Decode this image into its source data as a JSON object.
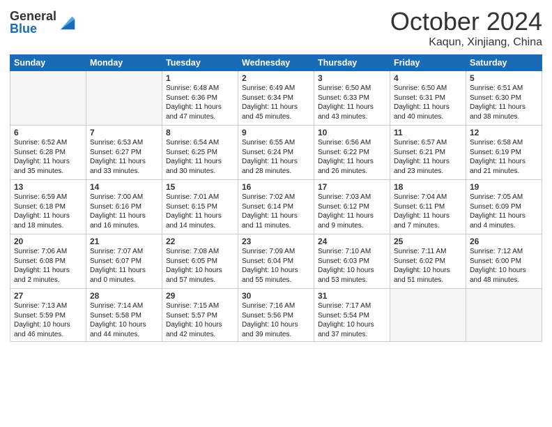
{
  "header": {
    "logo_general": "General",
    "logo_blue": "Blue",
    "month_title": "October 2024",
    "location": "Kaqun, Xinjiang, China"
  },
  "days_of_week": [
    "Sunday",
    "Monday",
    "Tuesday",
    "Wednesday",
    "Thursday",
    "Friday",
    "Saturday"
  ],
  "weeks": [
    [
      {
        "day": "",
        "info": ""
      },
      {
        "day": "",
        "info": ""
      },
      {
        "day": "1",
        "info": "Sunrise: 6:48 AM\nSunset: 6:36 PM\nDaylight: 11 hours and 47 minutes."
      },
      {
        "day": "2",
        "info": "Sunrise: 6:49 AM\nSunset: 6:34 PM\nDaylight: 11 hours and 45 minutes."
      },
      {
        "day": "3",
        "info": "Sunrise: 6:50 AM\nSunset: 6:33 PM\nDaylight: 11 hours and 43 minutes."
      },
      {
        "day": "4",
        "info": "Sunrise: 6:50 AM\nSunset: 6:31 PM\nDaylight: 11 hours and 40 minutes."
      },
      {
        "day": "5",
        "info": "Sunrise: 6:51 AM\nSunset: 6:30 PM\nDaylight: 11 hours and 38 minutes."
      }
    ],
    [
      {
        "day": "6",
        "info": "Sunrise: 6:52 AM\nSunset: 6:28 PM\nDaylight: 11 hours and 35 minutes."
      },
      {
        "day": "7",
        "info": "Sunrise: 6:53 AM\nSunset: 6:27 PM\nDaylight: 11 hours and 33 minutes."
      },
      {
        "day": "8",
        "info": "Sunrise: 6:54 AM\nSunset: 6:25 PM\nDaylight: 11 hours and 30 minutes."
      },
      {
        "day": "9",
        "info": "Sunrise: 6:55 AM\nSunset: 6:24 PM\nDaylight: 11 hours and 28 minutes."
      },
      {
        "day": "10",
        "info": "Sunrise: 6:56 AM\nSunset: 6:22 PM\nDaylight: 11 hours and 26 minutes."
      },
      {
        "day": "11",
        "info": "Sunrise: 6:57 AM\nSunset: 6:21 PM\nDaylight: 11 hours and 23 minutes."
      },
      {
        "day": "12",
        "info": "Sunrise: 6:58 AM\nSunset: 6:19 PM\nDaylight: 11 hours and 21 minutes."
      }
    ],
    [
      {
        "day": "13",
        "info": "Sunrise: 6:59 AM\nSunset: 6:18 PM\nDaylight: 11 hours and 18 minutes."
      },
      {
        "day": "14",
        "info": "Sunrise: 7:00 AM\nSunset: 6:16 PM\nDaylight: 11 hours and 16 minutes."
      },
      {
        "day": "15",
        "info": "Sunrise: 7:01 AM\nSunset: 6:15 PM\nDaylight: 11 hours and 14 minutes."
      },
      {
        "day": "16",
        "info": "Sunrise: 7:02 AM\nSunset: 6:14 PM\nDaylight: 11 hours and 11 minutes."
      },
      {
        "day": "17",
        "info": "Sunrise: 7:03 AM\nSunset: 6:12 PM\nDaylight: 11 hours and 9 minutes."
      },
      {
        "day": "18",
        "info": "Sunrise: 7:04 AM\nSunset: 6:11 PM\nDaylight: 11 hours and 7 minutes."
      },
      {
        "day": "19",
        "info": "Sunrise: 7:05 AM\nSunset: 6:09 PM\nDaylight: 11 hours and 4 minutes."
      }
    ],
    [
      {
        "day": "20",
        "info": "Sunrise: 7:06 AM\nSunset: 6:08 PM\nDaylight: 11 hours and 2 minutes."
      },
      {
        "day": "21",
        "info": "Sunrise: 7:07 AM\nSunset: 6:07 PM\nDaylight: 11 hours and 0 minutes."
      },
      {
        "day": "22",
        "info": "Sunrise: 7:08 AM\nSunset: 6:05 PM\nDaylight: 10 hours and 57 minutes."
      },
      {
        "day": "23",
        "info": "Sunrise: 7:09 AM\nSunset: 6:04 PM\nDaylight: 10 hours and 55 minutes."
      },
      {
        "day": "24",
        "info": "Sunrise: 7:10 AM\nSunset: 6:03 PM\nDaylight: 10 hours and 53 minutes."
      },
      {
        "day": "25",
        "info": "Sunrise: 7:11 AM\nSunset: 6:02 PM\nDaylight: 10 hours and 51 minutes."
      },
      {
        "day": "26",
        "info": "Sunrise: 7:12 AM\nSunset: 6:00 PM\nDaylight: 10 hours and 48 minutes."
      }
    ],
    [
      {
        "day": "27",
        "info": "Sunrise: 7:13 AM\nSunset: 5:59 PM\nDaylight: 10 hours and 46 minutes."
      },
      {
        "day": "28",
        "info": "Sunrise: 7:14 AM\nSunset: 5:58 PM\nDaylight: 10 hours and 44 minutes."
      },
      {
        "day": "29",
        "info": "Sunrise: 7:15 AM\nSunset: 5:57 PM\nDaylight: 10 hours and 42 minutes."
      },
      {
        "day": "30",
        "info": "Sunrise: 7:16 AM\nSunset: 5:56 PM\nDaylight: 10 hours and 39 minutes."
      },
      {
        "day": "31",
        "info": "Sunrise: 7:17 AM\nSunset: 5:54 PM\nDaylight: 10 hours and 37 minutes."
      },
      {
        "day": "",
        "info": ""
      },
      {
        "day": "",
        "info": ""
      }
    ]
  ]
}
